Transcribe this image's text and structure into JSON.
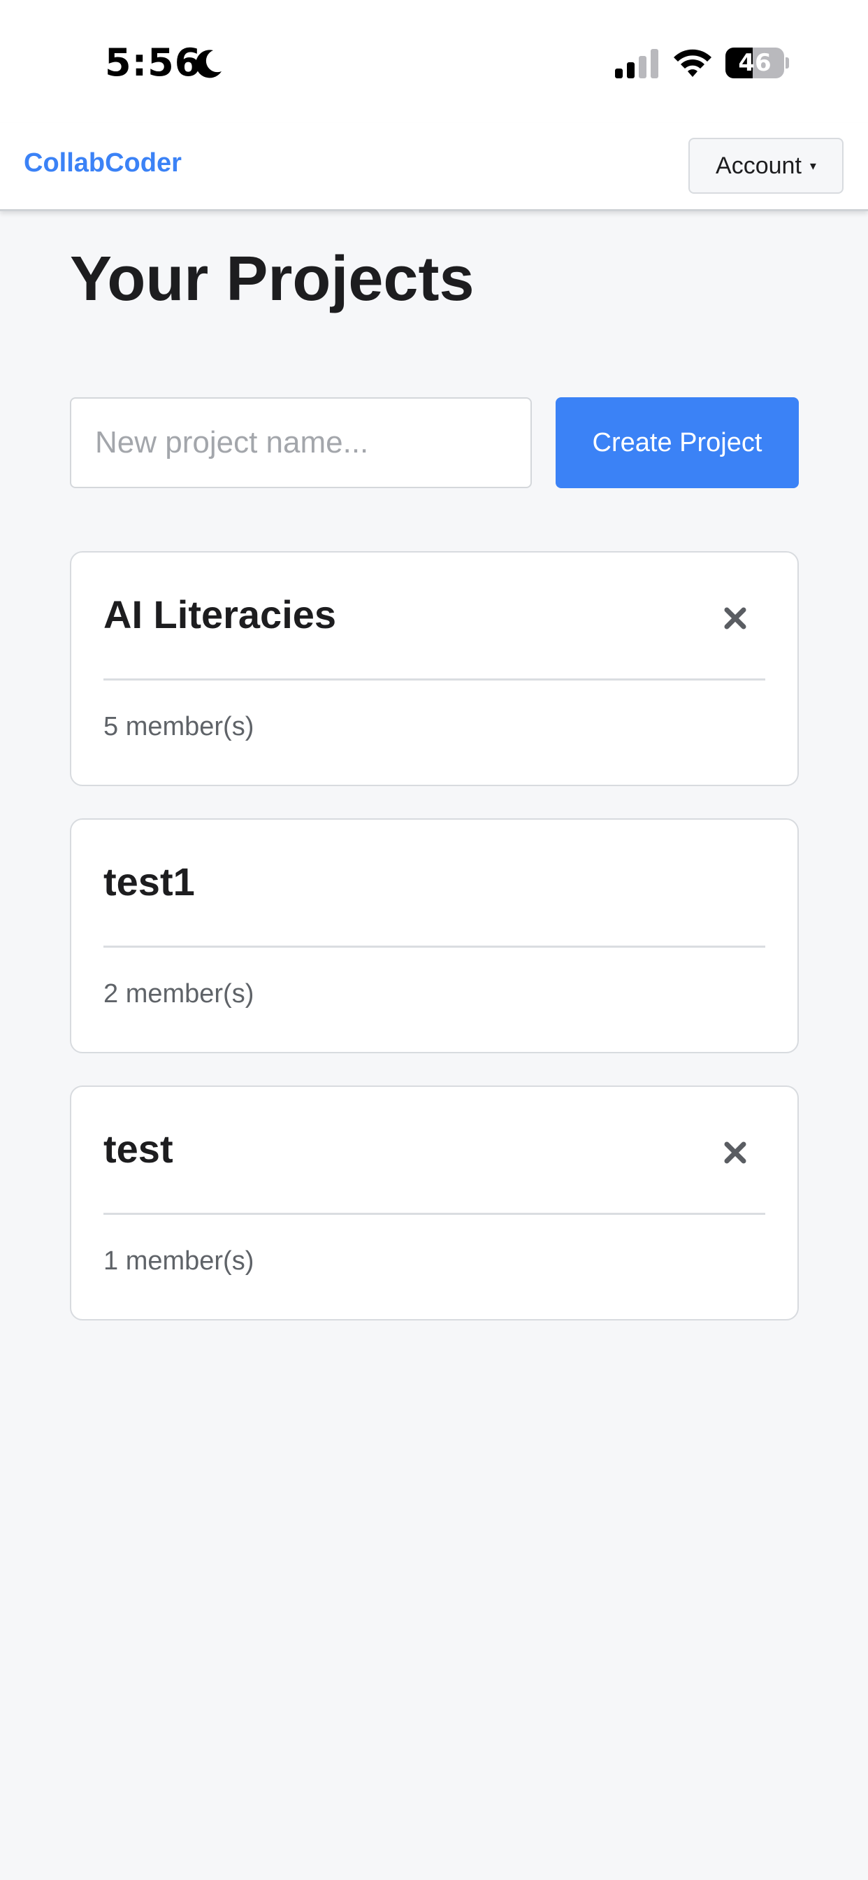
{
  "status_bar": {
    "time": "5:56",
    "battery_level": "46",
    "battery_fraction": 0.46,
    "icons": [
      "moon-icon",
      "signal-icon",
      "wifi-icon",
      "battery-icon"
    ]
  },
  "header": {
    "brand": "CollabCoder",
    "account_label": "Account",
    "account_caret": "▾"
  },
  "main": {
    "title": "Your Projects",
    "new_project": {
      "value": "",
      "placeholder": "New project name..."
    },
    "create_label": "Create Project",
    "projects": [
      {
        "name": "AI Literacies",
        "members": "5 member(s)",
        "deletable": true
      },
      {
        "name": "test1",
        "members": "2 member(s)",
        "deletable": false
      },
      {
        "name": "test",
        "members": "1 member(s)",
        "deletable": true
      }
    ]
  },
  "colors": {
    "accent": "#3b82f6",
    "background": "#f6f7f9",
    "card_border": "#d8dbdf"
  }
}
